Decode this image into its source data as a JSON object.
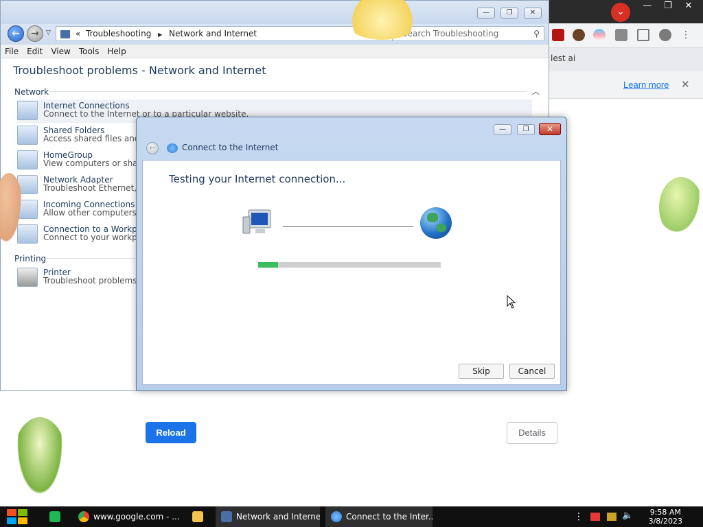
{
  "chrome": {
    "partial_text": "lest ai",
    "learn_more": "Learn more",
    "close_info": "✕",
    "reload_label": "Reload",
    "details_label": "Details",
    "win_min": "—",
    "win_max": "❐",
    "win_close": "✕",
    "profile_badge": "⌄"
  },
  "explorer": {
    "breadcrumb_sep": "«",
    "breadcrumb": [
      "Troubleshooting",
      "Network and Internet"
    ],
    "breadcrumb_arrow": "▶",
    "search_placeholder": "Search Troubleshooting",
    "menu": [
      "File",
      "Edit",
      "View",
      "Tools",
      "Help"
    ],
    "heading": "Troubleshoot problems - Network and Internet",
    "win_min": "—",
    "win_max": "❐",
    "win_close": "✕",
    "sections": [
      {
        "label": "Network",
        "items": [
          {
            "title": "Internet Connections",
            "desc": "Connect to the Internet or to a particular website."
          },
          {
            "title": "Shared Folders",
            "desc": "Access shared files and f"
          },
          {
            "title": "HomeGroup",
            "desc": "View computers or share"
          },
          {
            "title": "Network Adapter",
            "desc": "Troubleshoot Ethernet, w"
          },
          {
            "title": "Incoming Connections",
            "desc": "Allow other computers to"
          },
          {
            "title": "Connection to a Workplac",
            "desc": "Connect to your workplac"
          }
        ]
      },
      {
        "label": "Printing",
        "items": [
          {
            "title": "Printer",
            "desc": "Troubleshoot problems p"
          }
        ]
      }
    ]
  },
  "dialog": {
    "title": "Connect to the Internet",
    "heading": "Testing your Internet connection...",
    "progress": 0.11,
    "skip_label": "Skip",
    "cancel_label": "Cancel",
    "close_glyph": "✕",
    "min_glyph": "—",
    "max_glyph": "❐"
  },
  "taskbar": {
    "items": [
      {
        "label": "www.google.com - ...",
        "icon": "chrome-icon"
      },
      {
        "label": "",
        "icon": "folder-icon"
      },
      {
        "label": "Network and Internet",
        "icon": "control-panel-icon"
      },
      {
        "label": "Connect to the Inter...",
        "icon": "network-wizard-icon"
      }
    ],
    "time": "9:58 AM",
    "date": "3/8/2023"
  },
  "colors": {
    "progress_fill": "#3dbb5f",
    "reload_blue": "#1a73e8",
    "taskbar": "#101010"
  }
}
